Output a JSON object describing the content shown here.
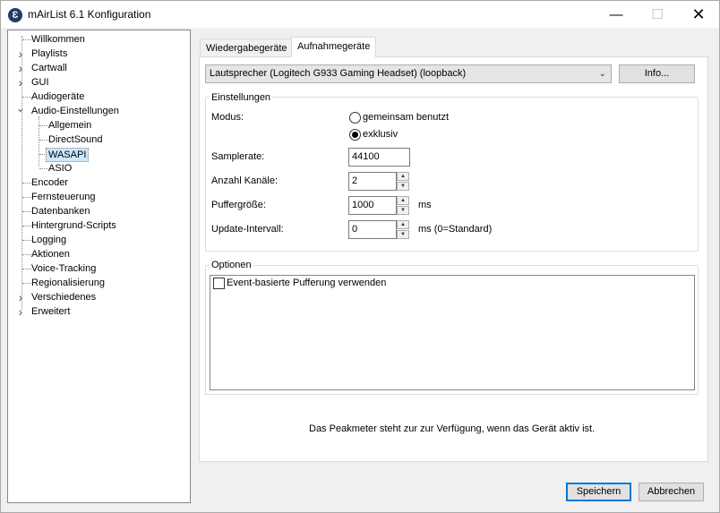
{
  "window": {
    "title": "mAirList 6.1 Konfiguration",
    "icon_letter": "Ɛ",
    "min_glyph": "—",
    "max_glyph": "☐",
    "close_glyph": "✕"
  },
  "tree": {
    "items": [
      {
        "label": "Willkommen"
      },
      {
        "label": "Playlists"
      },
      {
        "label": "Cartwall"
      },
      {
        "label": "GUI"
      },
      {
        "label": "Audiogeräte"
      },
      {
        "label": "Audio-Einstellungen"
      },
      {
        "label": "Allgemein"
      },
      {
        "label": "DirectSound"
      },
      {
        "label": "WASAPI"
      },
      {
        "label": "ASIO"
      },
      {
        "label": "Encoder"
      },
      {
        "label": "Fernsteuerung"
      },
      {
        "label": "Datenbanken"
      },
      {
        "label": "Hintergrund-Scripts"
      },
      {
        "label": "Logging"
      },
      {
        "label": "Aktionen"
      },
      {
        "label": "Voice-Tracking"
      },
      {
        "label": "Regionalisierung"
      },
      {
        "label": "Verschiedenes"
      },
      {
        "label": "Erweitert"
      }
    ],
    "selected": "WASAPI",
    "chevron_right": "›",
    "chevron_down": "⌄"
  },
  "tabs": [
    {
      "label": "Wiedergabegeräte"
    },
    {
      "label": "Aufnahmegeräte"
    }
  ],
  "active_tab": "Aufnahmegeräte",
  "device": {
    "selected": "Lautsprecher (Logitech G933 Gaming Headset) (loopback)",
    "info_button": "Info..."
  },
  "settings": {
    "group_title": "Einstellungen",
    "modus_label": "Modus:",
    "modus_options": [
      "gemeinsam benutzt",
      "exklusiv"
    ],
    "modus_selected": "exklusiv",
    "samplerate_label": "Samplerate:",
    "samplerate_value": "44100",
    "kanaele_label": "Anzahl Kanäle:",
    "kanaele_value": "2",
    "puffer_label": "Puffergröße:",
    "puffer_value": "1000",
    "puffer_unit": "ms",
    "update_label": "Update-Intervall:",
    "update_value": "0",
    "update_unit": "ms (0=Standard)",
    "spin_up": "▲",
    "spin_down": "▼"
  },
  "options": {
    "group_title": "Optionen",
    "items": [
      {
        "label": "Event-basierte Pufferung verwenden",
        "checked": false
      }
    ]
  },
  "status_text": "Das Peakmeter steht zur zur Verfügung, wenn das Gerät aktiv ist.",
  "footer": {
    "save_label": "Speichern",
    "cancel_label": "Abbrechen"
  }
}
